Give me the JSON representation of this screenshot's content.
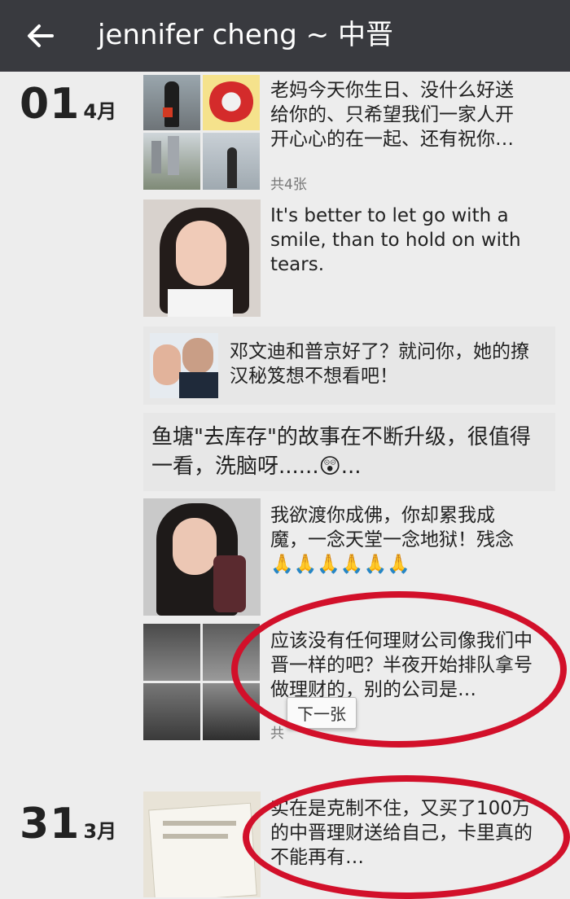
{
  "header": {
    "title": "jennifer cheng ~ 中晋"
  },
  "dates": [
    {
      "day": "01",
      "month": "4月"
    },
    {
      "day": "31",
      "month": "3月"
    }
  ],
  "posts": [
    {
      "text": "老妈今天你生日、没什么好送给你的、只希望我们一家人开开心心的在一起、还有祝你…",
      "count": "共4张"
    },
    {
      "text": "It's better to let go with a smile, than to hold on with tears."
    },
    {
      "text": "邓文迪和普京好了？就问你，她的撩汉秘笈想不想看吧！"
    },
    {
      "text": "鱼塘\"去库存\"的故事在不断升级，很值得一看，洗脑呀......😲..."
    },
    {
      "text": "我欲渡你成佛，你却累我成魔，一念天堂一念地狱！残念🙏🙏🙏🙏🙏🙏"
    },
    {
      "text": "应该没有任何理财公司像我们中晋一样的吧？半夜开始排队拿号做理财的，别的公司是…",
      "count": "共"
    },
    {
      "text": "实在是克制不住，又买了100万的中晋理财送给自己，卡里真的不能再有…"
    }
  ],
  "tooltip": "下一张",
  "colors": {
    "topbar": "#393a3f",
    "background": "#ededed",
    "annotation": "#d2102a"
  }
}
